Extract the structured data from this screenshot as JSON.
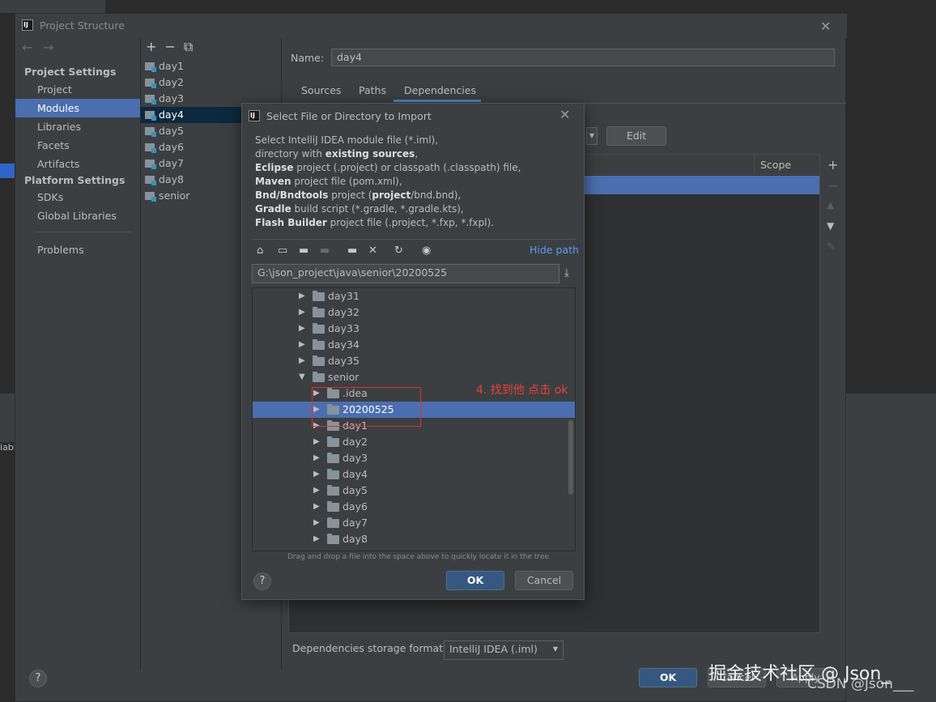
{
  "window": {
    "title": "Project Structure",
    "app_icon": "IJ"
  },
  "nav": {
    "project_settings_header": "Project Settings",
    "project_settings": [
      "Project",
      "Modules",
      "Libraries",
      "Facets",
      "Artifacts"
    ],
    "platform_settings_header": "Platform Settings",
    "platform_settings": [
      "SDKs",
      "Global Libraries"
    ],
    "problems": "Problems",
    "selected": "Modules"
  },
  "modules": {
    "items": [
      "day1",
      "day2",
      "day3",
      "day4",
      "day5",
      "day6",
      "day7",
      "day8",
      "senior"
    ],
    "selected": "day4"
  },
  "module_detail": {
    "name_label": "Name:",
    "name_value": "day4",
    "tabs": [
      "Sources",
      "Paths",
      "Dependencies"
    ],
    "active_tab": "Dependencies",
    "edit_button": "Edit",
    "scope_header": "Scope",
    "storage_label": "Dependencies storage format:",
    "storage_value": "IntelliJ IDEA (.iml)"
  },
  "footer": {
    "ok": "OK",
    "cancel": "Cancel",
    "apply": "Apply"
  },
  "dialog": {
    "title": "Select File or Directory to Import",
    "desc": [
      {
        "pre": "",
        "bold": "",
        "post": "Select IntelliJ IDEA module file (*.iml),"
      },
      {
        "pre": "directory with ",
        "bold": "existing sources",
        "post": ","
      },
      {
        "pre": "",
        "bold": "Eclipse",
        "post": " project (.project) or classpath (.classpath) file,"
      },
      {
        "pre": "",
        "bold": "Maven",
        "post": " project file (pom.xml),"
      },
      {
        "pre": "",
        "bold": "Bnd/Bndtools",
        "post": " project (",
        "bold2": "project",
        "post2": "/bnd.bnd),"
      },
      {
        "pre": "",
        "bold": "Gradle",
        "post": " build script (*.gradle, *.gradle.kts),"
      },
      {
        "pre": "",
        "bold": "Flash Builder",
        "post": " project file (.project, *.fxp, *.fxpl)."
      }
    ],
    "hide_path": "Hide path",
    "path": "G:\\json_project\\java\\senior\\20200525",
    "tree": [
      {
        "label": "day31",
        "level": 0,
        "expanded": false
      },
      {
        "label": "day32",
        "level": 0,
        "expanded": false
      },
      {
        "label": "day33",
        "level": 0,
        "expanded": false
      },
      {
        "label": "day34",
        "level": 0,
        "expanded": false
      },
      {
        "label": "day35",
        "level": 0,
        "expanded": false
      },
      {
        "label": "senior",
        "level": 0,
        "expanded": true
      },
      {
        "label": ".idea",
        "level": 1,
        "expanded": false
      },
      {
        "label": "20200525",
        "level": 1,
        "expanded": false,
        "selected": true
      },
      {
        "label": "day1",
        "level": 1,
        "expanded": false
      },
      {
        "label": "day2",
        "level": 1,
        "expanded": false
      },
      {
        "label": "day3",
        "level": 1,
        "expanded": false
      },
      {
        "label": "day4",
        "level": 1,
        "expanded": false
      },
      {
        "label": "day5",
        "level": 1,
        "expanded": false
      },
      {
        "label": "day6",
        "level": 1,
        "expanded": false
      },
      {
        "label": "day7",
        "level": 1,
        "expanded": false
      },
      {
        "label": "day8",
        "level": 1,
        "expanded": false
      }
    ],
    "drag_hint": "Drag and drop a file into the space above to quickly locate it in the tree",
    "ok": "OK",
    "cancel": "Cancel",
    "help": "?"
  },
  "annotation": "4. 找到他 点击 ok",
  "watermark": {
    "line1": "掘金技术社区 @ Json_",
    "line2": "CSDN @Json___"
  },
  "colors": {
    "selection": "#4b6eaf",
    "annotation": "#e9403a",
    "link": "#589df6"
  }
}
